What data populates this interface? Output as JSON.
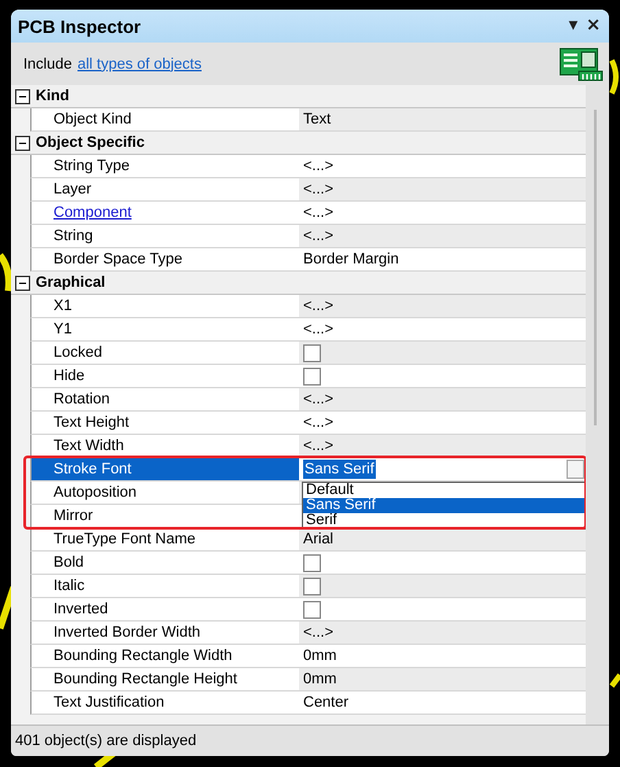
{
  "window": {
    "title": "PCB Inspector",
    "buttons": [
      "▾",
      "×"
    ]
  },
  "filter": {
    "prefix": "Include",
    "link": "all types of objects"
  },
  "sections": [
    {
      "title": "Kind",
      "expanded": true,
      "rows": [
        {
          "label": "Object Kind",
          "kind": "text",
          "value": "Text",
          "selected": false
        }
      ]
    },
    {
      "title": "Object Specific",
      "expanded": true,
      "rows": [
        {
          "label": "String Type",
          "kind": "text",
          "value": "<...>",
          "selected": false
        },
        {
          "label": "Layer",
          "kind": "text",
          "value": "<...>",
          "selected": false
        },
        {
          "label": "Component",
          "kind": "text",
          "label_link": true,
          "value": "<...>",
          "selected": false
        },
        {
          "label": "String",
          "kind": "text",
          "value": "<...>",
          "selected": false
        },
        {
          "label": "Border Space Type",
          "kind": "text",
          "value": "Border Margin",
          "selected": false
        }
      ]
    },
    {
      "title": "Graphical",
      "expanded": true,
      "rows": [
        {
          "label": "X1",
          "kind": "text",
          "value": "<...>",
          "selected": false
        },
        {
          "label": "Y1",
          "kind": "text",
          "value": "<...>",
          "selected": false
        },
        {
          "label": "Locked",
          "kind": "checkbox",
          "checked": false,
          "selected": false
        },
        {
          "label": "Hide",
          "kind": "checkbox",
          "checked": false,
          "selected": false
        },
        {
          "label": "Rotation",
          "kind": "text",
          "value": "<...>",
          "selected": false
        },
        {
          "label": "Text Height",
          "kind": "text",
          "value": "<...>",
          "selected": false
        },
        {
          "label": "Text Width",
          "kind": "text",
          "value": "<...>",
          "selected": false
        },
        {
          "label": "Stroke Font",
          "kind": "combo",
          "value": "Sans Serif",
          "selected": true,
          "highlighted": true,
          "options": [
            {
              "label": "Default",
              "selected": false
            },
            {
              "label": "Sans Serif",
              "selected": true
            },
            {
              "label": "Serif",
              "selected": false
            }
          ]
        },
        {
          "label": "Autoposition",
          "kind": "text",
          "selected": false
        },
        {
          "label": "Mirror",
          "kind": "text",
          "selected": false
        },
        {
          "label": "TrueType Font Name",
          "kind": "text",
          "value": "Arial",
          "selected": false
        },
        {
          "label": "Bold",
          "kind": "checkbox",
          "checked": false,
          "selected": false
        },
        {
          "label": "Italic",
          "kind": "checkbox",
          "checked": false,
          "selected": false
        },
        {
          "label": "Inverted",
          "kind": "checkbox",
          "checked": false,
          "selected": false
        },
        {
          "label": "Inverted Border Width",
          "kind": "text",
          "value": "<...>",
          "selected": false
        },
        {
          "label": "Bounding Rectangle Width",
          "kind": "text",
          "value": "0mm",
          "selected": false
        },
        {
          "label": "Bounding Rectangle Height",
          "kind": "text",
          "value": "0mm",
          "selected": false
        },
        {
          "label": "Text Justification",
          "kind": "text",
          "value": "Center",
          "selected": false
        }
      ]
    }
  ],
  "status_bar": "401 object(s) are displayed"
}
